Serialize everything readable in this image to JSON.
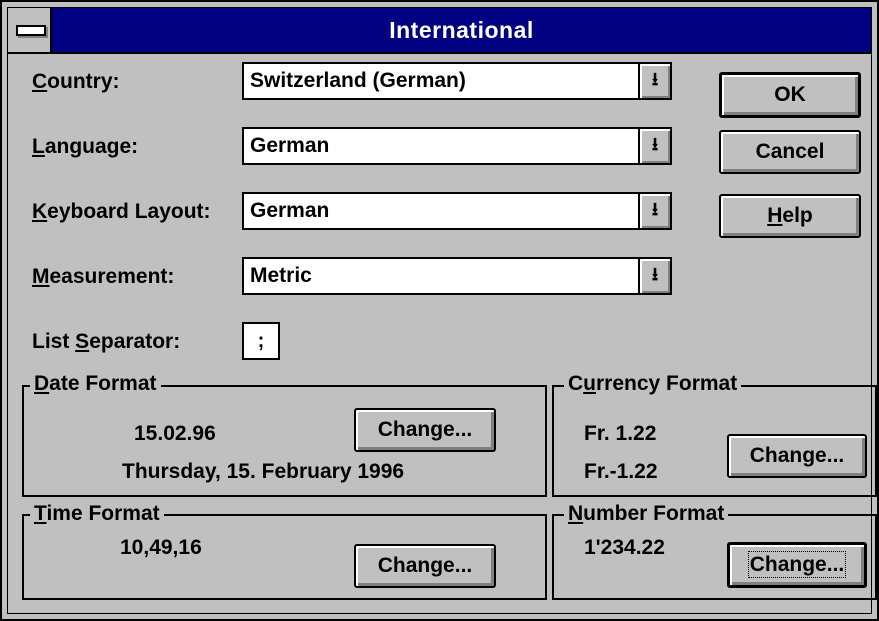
{
  "window": {
    "title": "International"
  },
  "fields": {
    "country": {
      "label_ul": "C",
      "label_rest": "ountry:",
      "value": "Switzerland (German)"
    },
    "language": {
      "label_ul": "L",
      "label_rest": "anguage:",
      "value": "German"
    },
    "keyboard": {
      "label_ul": "K",
      "label_rest": "eyboard Layout:",
      "value": "German"
    },
    "measurement": {
      "label_ul": "M",
      "label_rest": "easurement:",
      "value": "Metric"
    },
    "list_separator": {
      "label_pre": "List ",
      "label_ul": "S",
      "label_rest": "eparator:",
      "value": ";"
    }
  },
  "buttons": {
    "ok": "OK",
    "cancel": "Cancel",
    "help_ul": "H",
    "help_rest": "elp",
    "change": "Change..."
  },
  "date_format": {
    "title_ul": "D",
    "title_rest": "ate Format",
    "short": "15.02.96",
    "long": "Thursday, 15. February 1996"
  },
  "currency_format": {
    "title_pre": "C",
    "title_ul": "u",
    "title_rest": "rrency Format",
    "positive": "Fr. 1.22",
    "negative": "Fr.-1.22"
  },
  "time_format": {
    "title_ul": "T",
    "title_rest": "ime Format",
    "value": "10,49,16"
  },
  "number_format": {
    "title_ul": "N",
    "title_rest": "umber Format",
    "value": "1'234.22"
  },
  "icons": {
    "dropdown": "dropdown-arrow-icon",
    "system_menu": "system-menu-icon"
  }
}
